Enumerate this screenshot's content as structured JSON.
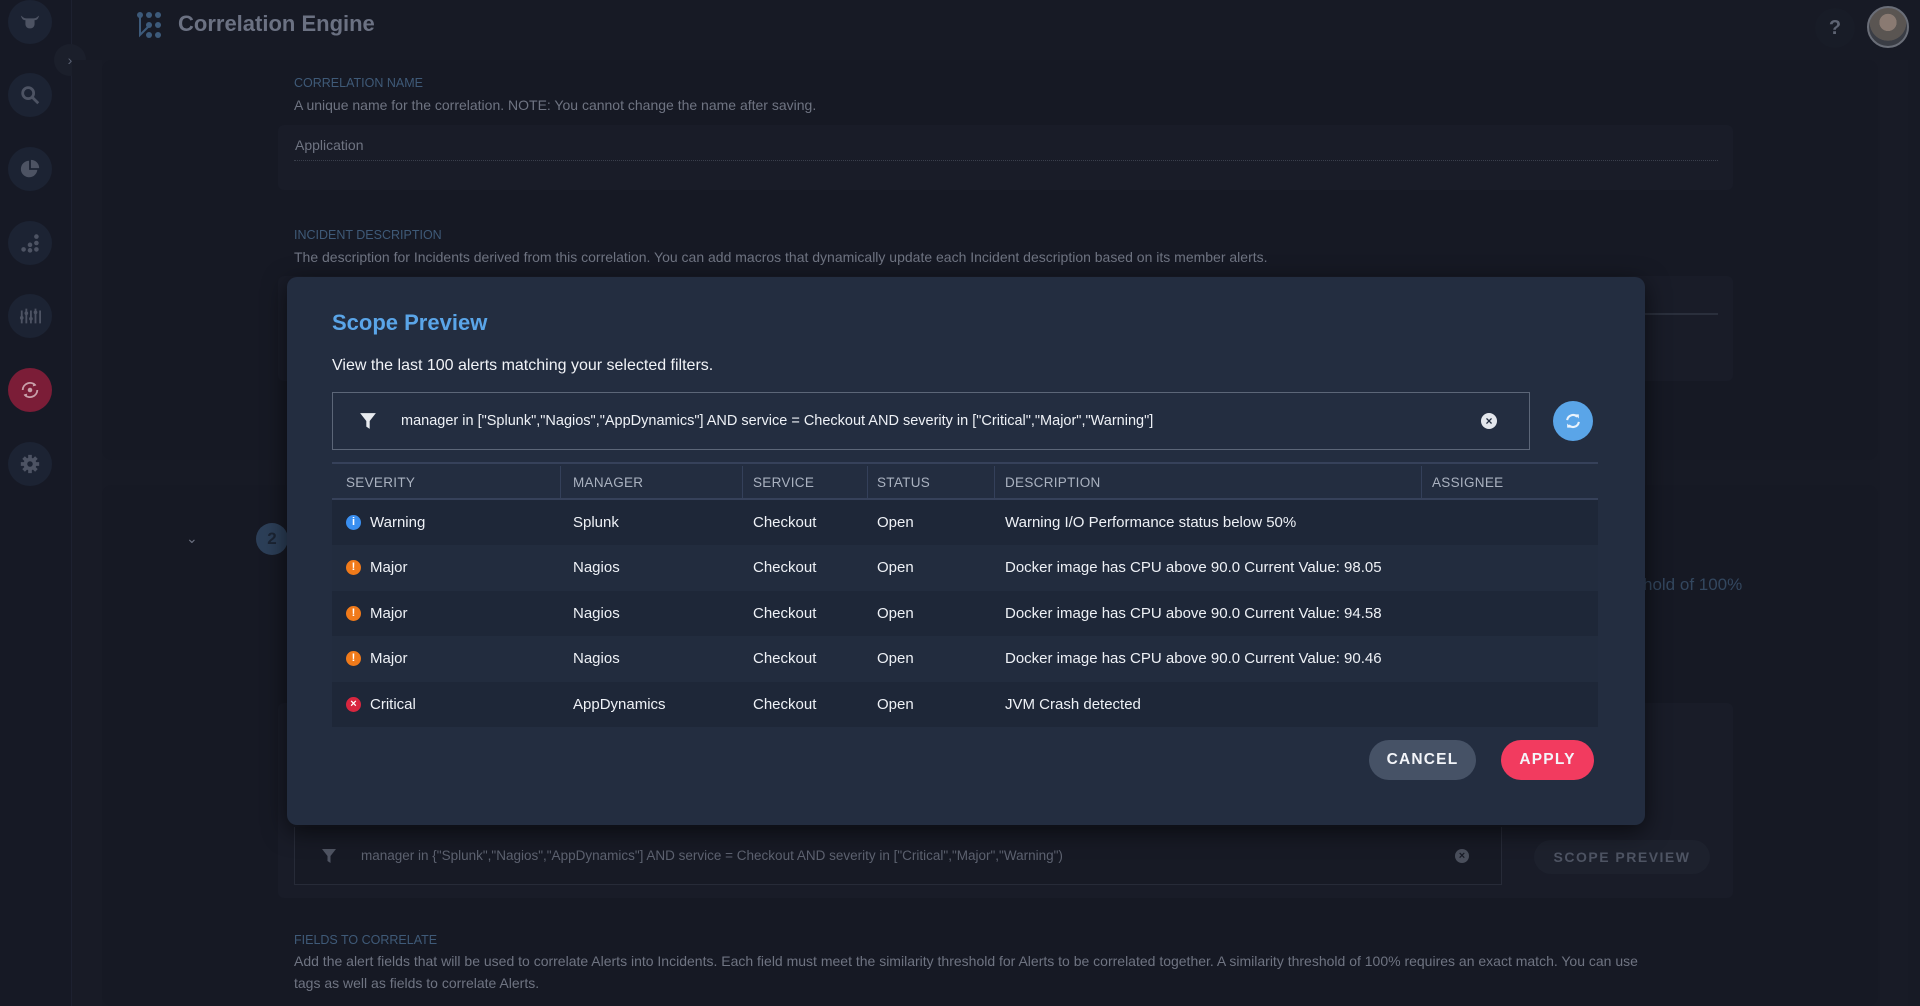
{
  "app": {
    "title": "Correlation Engine",
    "help_label": "?"
  },
  "sidebar": {
    "items": [
      {
        "icon": "bull-logo-icon",
        "active": false
      },
      {
        "icon": "search-icon",
        "active": false
      },
      {
        "icon": "pie-chart-icon",
        "active": false
      },
      {
        "icon": "bar-chart-icon",
        "active": false
      },
      {
        "icon": "sliders-icon",
        "active": false
      },
      {
        "icon": "correlation-icon",
        "active": true
      },
      {
        "icon": "gear-icon",
        "active": false
      }
    ],
    "expand_label": "›"
  },
  "background_form": {
    "correlation_name": {
      "label": "CORRELATION NAME",
      "help": "A unique name for the correlation. NOTE: You cannot change the name after saving.",
      "value": "Application"
    },
    "incident_description": {
      "label": "INCIDENT DESCRIPTION",
      "help": "The description for Incidents derived from this correlation. You can add macros that dynamically update each Incident description based on its member alerts."
    },
    "step_number": "2",
    "step_chevron": "⌄",
    "threshold_fragment": "hold of 100%",
    "filter": {
      "query": "manager in {\"Splunk\",\"Nagios\",\"AppDynamics\"] AND service = Checkout AND severity in [\"Critical\",\"Major\",\"Warning\")",
      "clear_label": "×"
    },
    "scope_preview_label": "SCOPE PREVIEW",
    "fields_to_correlate": {
      "label": "FIELDS TO CORRELATE",
      "help_line1": "Add the alert fields that will be used to correlate Alerts into Incidents. Each field must meet the similarity threshold for Alerts to be correlated together. A similarity threshold of 100% requires an exact match. You can use",
      "help_line2": "tags as well as fields to correlate Alerts."
    }
  },
  "modal": {
    "title": "Scope Preview",
    "subtitle": "View the last 100 alerts matching your selected filters.",
    "filter": {
      "query": "manager in [\"Splunk\",\"Nagios\",\"AppDynamics\"] AND service = Checkout AND severity in [\"Critical\",\"Major\",\"Warning\"]",
      "clear_label": "×"
    },
    "table": {
      "columns": [
        "SEVERITY",
        "MANAGER",
        "SERVICE",
        "STATUS",
        "DESCRIPTION",
        "ASSIGNEE"
      ],
      "rows": [
        {
          "severity": "Warning",
          "severity_icon": "i",
          "severity_color": "#3a8ff0",
          "manager": "Splunk",
          "service": "Checkout",
          "status": "Open",
          "description": "Warning I/O Performance status below 50%",
          "assignee": ""
        },
        {
          "severity": "Major",
          "severity_icon": "!",
          "severity_color": "#f07a1a",
          "manager": "Nagios",
          "service": "Checkout",
          "status": "Open",
          "description": "Docker image has CPU above 90.0 Current Value: 98.05",
          "assignee": ""
        },
        {
          "severity": "Major",
          "severity_icon": "!",
          "severity_color": "#f07a1a",
          "manager": "Nagios",
          "service": "Checkout",
          "status": "Open",
          "description": "Docker image has CPU above 90.0 Current Value: 94.58",
          "assignee": ""
        },
        {
          "severity": "Major",
          "severity_icon": "!",
          "severity_color": "#f07a1a",
          "manager": "Nagios",
          "service": "Checkout",
          "status": "Open",
          "description": "Docker image has CPU above 90.0 Current Value: 90.46",
          "assignee": ""
        },
        {
          "severity": "Critical",
          "severity_icon": "×",
          "severity_color": "#d8263f",
          "manager": "AppDynamics",
          "service": "Checkout",
          "status": "Open",
          "description": "JVM Crash detected",
          "assignee": ""
        }
      ]
    },
    "cancel_label": "CANCEL",
    "apply_label": "APPLY"
  },
  "colors": {
    "accent_blue": "#5aa5e8",
    "apply_red": "#f23b5f",
    "active_nav": "#7b1d37"
  }
}
